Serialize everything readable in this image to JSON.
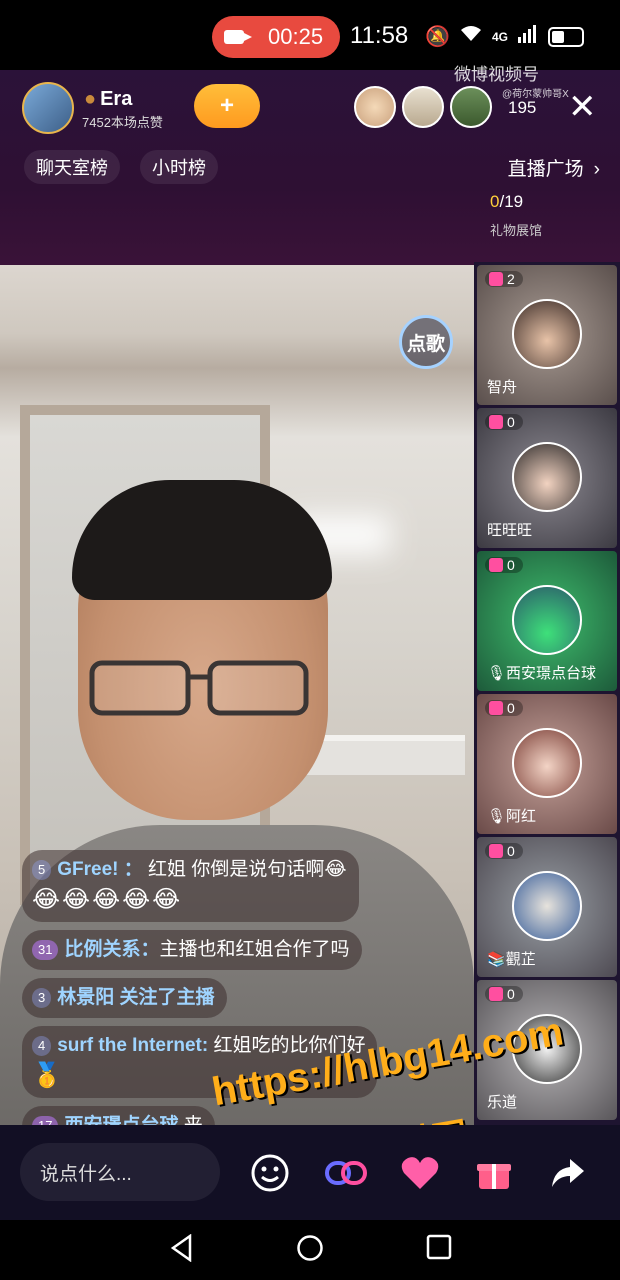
{
  "status_bar": {
    "recording_time": "00:25",
    "clock": "11:58",
    "network": "4G"
  },
  "header": {
    "host_name": "Era",
    "host_likes": "7452本场点赞",
    "follow_symbol": "+",
    "viewer_count": "195",
    "watermark_title": "微博视频号",
    "watermark_sub": "@荷尔蒙帅哥X"
  },
  "tabs": {
    "chat_rank": "聊天室榜",
    "hour_rank": "小时榜",
    "plaza": "直播广场"
  },
  "rank_mini": {
    "progress_current": "0",
    "progress_total": "/19",
    "gift_hall": "礼物展馆"
  },
  "video": {
    "song_button": "点歌"
  },
  "chat": [
    {
      "level": "5",
      "user": "GFree! ：",
      "text": "红姐 你倒是说句话啊😂",
      "extra": "😂😂😂😂😂"
    },
    {
      "level": "31",
      "user": "比例关系：",
      "text": "主播也和红姐合作了吗"
    },
    {
      "level": "3",
      "user": "林景阳",
      "text": "关注了主播"
    },
    {
      "level": "4",
      "user": "surf the Internet:",
      "text": "红姐吃的比你们好",
      "extra": "🥇"
    },
    {
      "level": "17",
      "user": "西安璟点台球",
      "text": "来"
    }
  ],
  "guests": [
    {
      "count": "2",
      "name": "智舟"
    },
    {
      "count": "0",
      "name": "旺旺旺"
    },
    {
      "count": "0",
      "name": "西安璟点台球"
    },
    {
      "count": "0",
      "name": "阿红"
    },
    {
      "count": "0",
      "name": "觀芷"
    },
    {
      "count": "0",
      "name": "乐道"
    }
  ],
  "bottom": {
    "input_placeholder": "说点什么..."
  },
  "overlay_watermark": {
    "url": "https://hlbg14.com",
    "site": "黑料网"
  },
  "colors": {
    "accent_orange": "#ffae1a",
    "record_red": "#e84a3f",
    "follow_gold": "#ffbe3a"
  }
}
